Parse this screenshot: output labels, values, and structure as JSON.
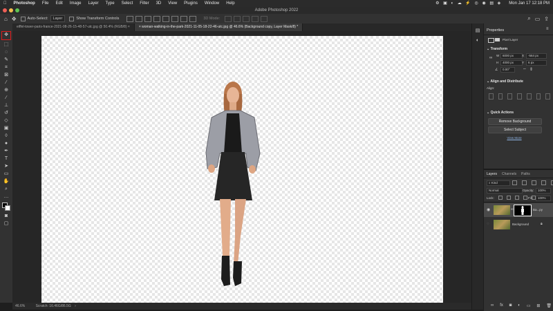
{
  "menubar": {
    "apple_icon": "apple-icon",
    "items": [
      "Photoshop",
      "File",
      "Edit",
      "Image",
      "Layer",
      "Type",
      "Select",
      "Filter",
      "3D",
      "View",
      "Plugins",
      "Window",
      "Help"
    ],
    "clock": "Mon Jan 17  12:18 PM"
  },
  "window": {
    "title": "Adobe Photoshop 2022"
  },
  "options": {
    "auto_select_label": "Auto-Select:",
    "auto_select_value": "Layer",
    "transform_label": "Show Transform Controls",
    "mode_3d": "3D Mode:"
  },
  "tabs": [
    {
      "label": "eiffel-tower-paris-france-2021-08-26-15-48-57-utc.jpg @ 50.4% (RGB/8)",
      "active": false
    },
    {
      "label": "woman-walking-in-the-park-2021-11-05-18-22-46-utc.jpg @ 46.6% (Background copy, Layer Mask/8) *",
      "active": true
    }
  ],
  "status": {
    "zoom": "46.6%",
    "scratch": "Scratch: 16.46G/86.5G"
  },
  "properties": {
    "tab": "Properties",
    "pixel_layer": "Pixel Layer",
    "transform_title": "Transform",
    "w_label": "W",
    "w_value": "6000 px",
    "x_label": "X",
    "x_value": "-564 px",
    "h_label": "H",
    "h_value": "4000 px",
    "y_label": "Y",
    "y_value": "6 px",
    "angle_value": "0.00°",
    "align_title": "Align and Distribute",
    "align_label": "Align:",
    "quick_title": "Quick Actions",
    "remove_bg": "Remove Background",
    "select_subject": "Select Subject",
    "view_more": "View More"
  },
  "layers": {
    "tabs": [
      "Layers",
      "Channels",
      "Paths"
    ],
    "kind": "Kind",
    "blend_mode": "Normal",
    "opacity_label": "Opacity:",
    "opacity_value": "100%",
    "lock_label": "Lock:",
    "fill_label": "Fill:",
    "fill_value": "100%",
    "rows": [
      {
        "name": "Ba...py",
        "selected": true
      },
      {
        "name": "Background",
        "selected": false
      }
    ]
  },
  "colors": {
    "highlight": "#e01b1b",
    "accent": "#8fb5e6"
  }
}
